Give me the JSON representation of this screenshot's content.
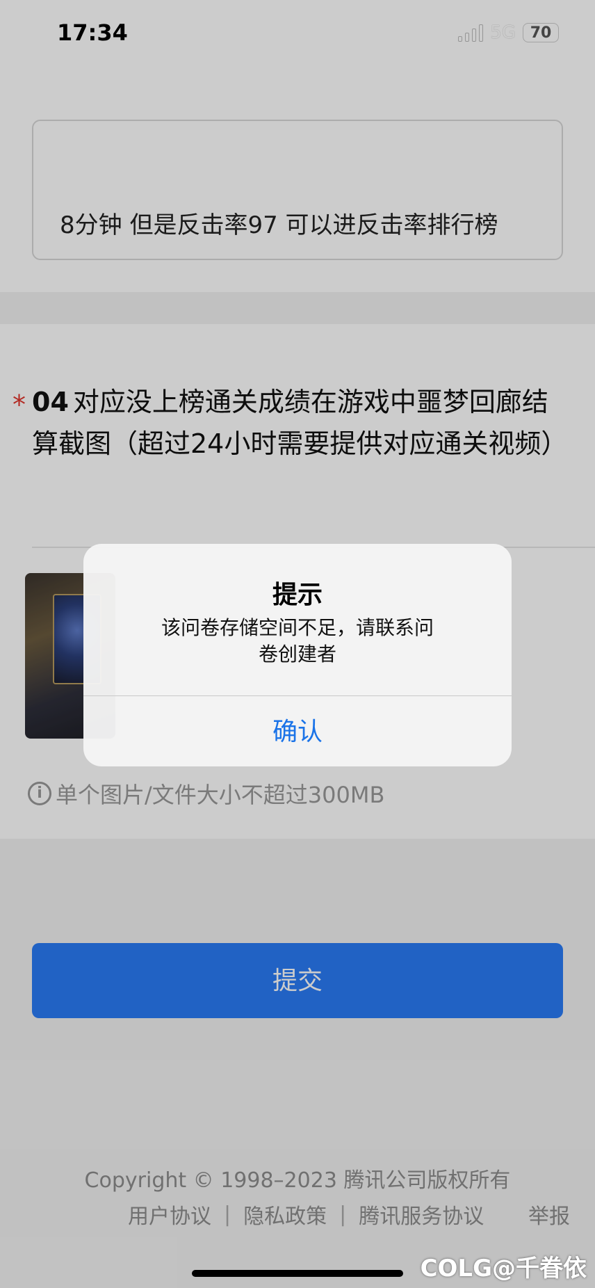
{
  "status_bar": {
    "time": "17:34",
    "network": "5G",
    "battery": "70",
    "signal_icon": "signal-bars-icon",
    "battery_icon": "battery-icon"
  },
  "progress": {
    "fraction": 0.4
  },
  "question3": {
    "answer": "8分钟 但是反击率97 可以进反击率排行榜"
  },
  "question4": {
    "required_mark": "*",
    "number": "04",
    "title": "对应没上榜通关成绩在游戏中噩梦回廊结算截图（超过24小时需要提供对应通关视频）",
    "upload_hint": "单个图片/文件大小不超过300MB",
    "hint_icon": "info-icon"
  },
  "submit_label": "提交",
  "footer": {
    "copyright": "Copyright © 1998–2023 腾讯公司版权所有",
    "links": [
      "用户协议",
      "隐私政策",
      "腾讯服务协议"
    ],
    "separator": "|",
    "report": "举报"
  },
  "dialog": {
    "title": "提示",
    "message": "该问卷存储空间不足，请联系问卷创建者",
    "confirm_label": "确认"
  },
  "watermark": "COLG@千眷依",
  "colors": {
    "accent": "#1f63d2",
    "submit": "#2a7bf6",
    "required": "#e0362e",
    "dialog_button": "#1a73e8"
  }
}
